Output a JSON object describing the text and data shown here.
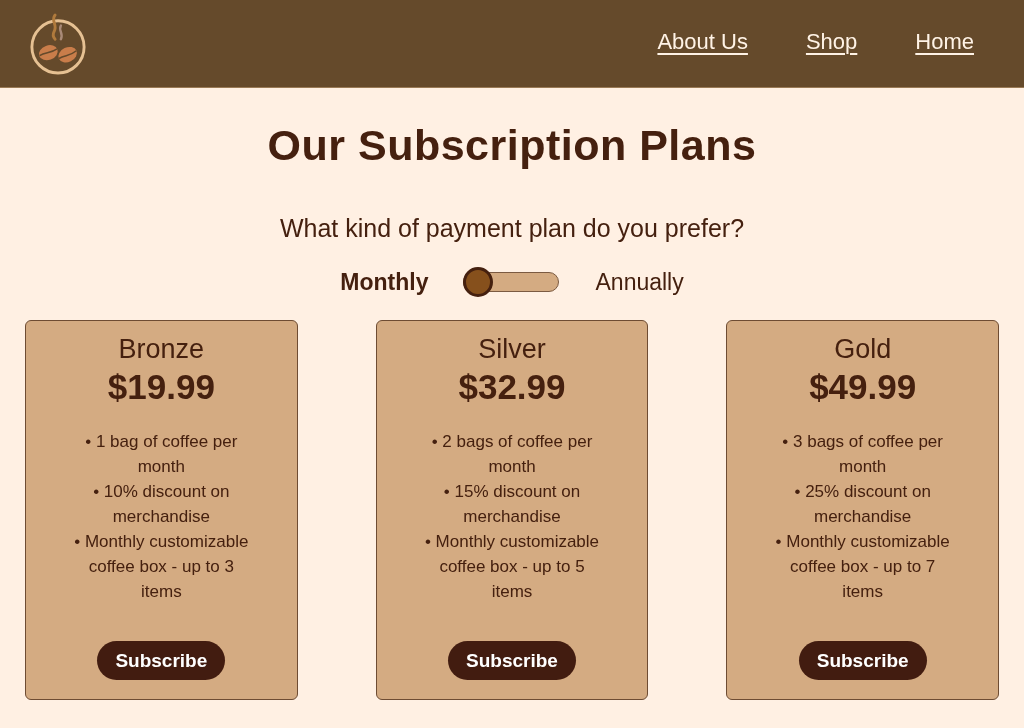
{
  "header": {
    "nav": [
      "About Us",
      "Shop",
      "Home"
    ]
  },
  "title": "Our Subscription Plans",
  "billing": {
    "question": "What kind of payment plan do you prefer?",
    "options": [
      {
        "label": "Monthly",
        "selected": true
      },
      {
        "label": "Annually",
        "selected": false
      }
    ]
  },
  "plans": [
    {
      "name": "Bronze",
      "price": "$19.99",
      "features": [
        "• 1 bag of coffee per month",
        "• 10% discount on merchandise",
        "• Monthly customizable coffee box - up to 3 items"
      ],
      "button": "Subscribe"
    },
    {
      "name": "Silver",
      "price": "$32.99",
      "features": [
        "• 2 bags of coffee per month",
        "• 15% discount on merchandise",
        "• Monthly customizable coffee box - up to 5 items"
      ],
      "button": "Subscribe"
    },
    {
      "name": "Gold",
      "price": "$49.99",
      "features": [
        "• 3 bags of coffee per month",
        "• 25% discount on merchandise",
        "• Monthly customizable coffee box - up to 7 items"
      ],
      "button": "Subscribe"
    }
  ]
}
